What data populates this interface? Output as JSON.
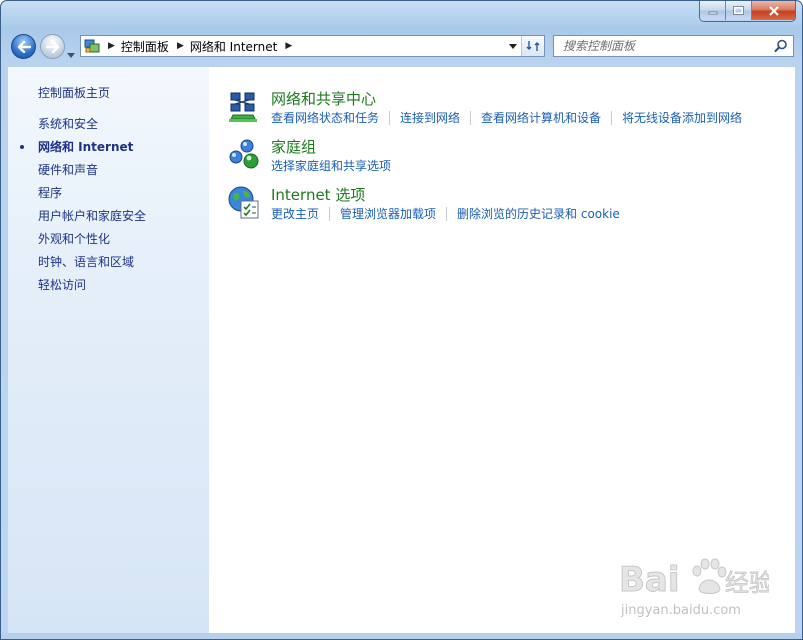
{
  "address_bar": {
    "crumbs": [
      "控制面板",
      "网络和 Internet"
    ]
  },
  "search": {
    "placeholder": "搜索控制面板"
  },
  "sidebar": {
    "home": "控制面板主页",
    "items": [
      {
        "label": "系统和安全",
        "active": false
      },
      {
        "label": "网络和 Internet",
        "active": true
      },
      {
        "label": "硬件和声音",
        "active": false
      },
      {
        "label": "程序",
        "active": false
      },
      {
        "label": "用户帐户和家庭安全",
        "active": false
      },
      {
        "label": "外观和个性化",
        "active": false
      },
      {
        "label": "时钟、语言和区域",
        "active": false
      },
      {
        "label": "轻松访问",
        "active": false
      }
    ]
  },
  "categories": [
    {
      "title": "网络和共享中心",
      "icon": "network-sharing-center-icon",
      "links": [
        "查看网络状态和任务",
        "连接到网络",
        "查看网络计算机和设备",
        "将无线设备添加到网络"
      ]
    },
    {
      "title": "家庭组",
      "icon": "homegroup-icon",
      "links": [
        "选择家庭组和共享选项"
      ]
    },
    {
      "title": "Internet 选项",
      "icon": "internet-options-icon",
      "links": [
        "更改主页",
        "管理浏览器加载项",
        "删除浏览的历史记录和 cookie"
      ]
    }
  ],
  "watermark": {
    "logo_text": "Bai度经验",
    "url": "jingyan.baidu.com"
  },
  "colors": {
    "link": "#1a5fb4",
    "category_title": "#1e7a1e",
    "sidebar_text": "#1e3287",
    "frame": "#b9d3ef"
  }
}
